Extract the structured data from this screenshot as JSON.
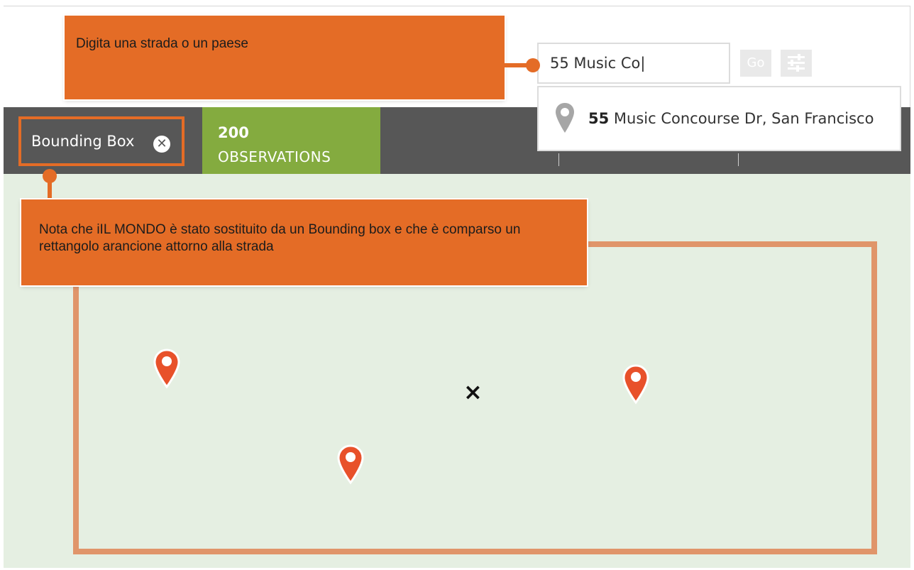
{
  "search": {
    "value": "55 Music Co|",
    "go_label": "Go",
    "filter_icon": "sliders-icon"
  },
  "suggestion": {
    "icon": "location-pin-icon",
    "bold": "55",
    "rest": " Music Concourse Dr, San Francisco"
  },
  "filters": {
    "chip_label": "Bounding Box",
    "chip_close_icon": "close-circle-icon"
  },
  "observations": {
    "count": "200",
    "label": "OBSERVATIONS"
  },
  "annotations": {
    "search_hint": "Digita una strada o un paese",
    "bbox_note": "Nota che iIL MONDO è stato sostituito da un Bounding box e che è comparso un rettangolo arancione attorno alla strada"
  },
  "map": {
    "pin_count": 3,
    "pin_color": "#e8512a",
    "center_marker": "×",
    "bbox_color": "#e0956a"
  },
  "colors": {
    "accent": "#e46c26",
    "nav_bg": "#575757",
    "obs_bg": "#84ab3f",
    "map_bg": "#e5efe2"
  }
}
